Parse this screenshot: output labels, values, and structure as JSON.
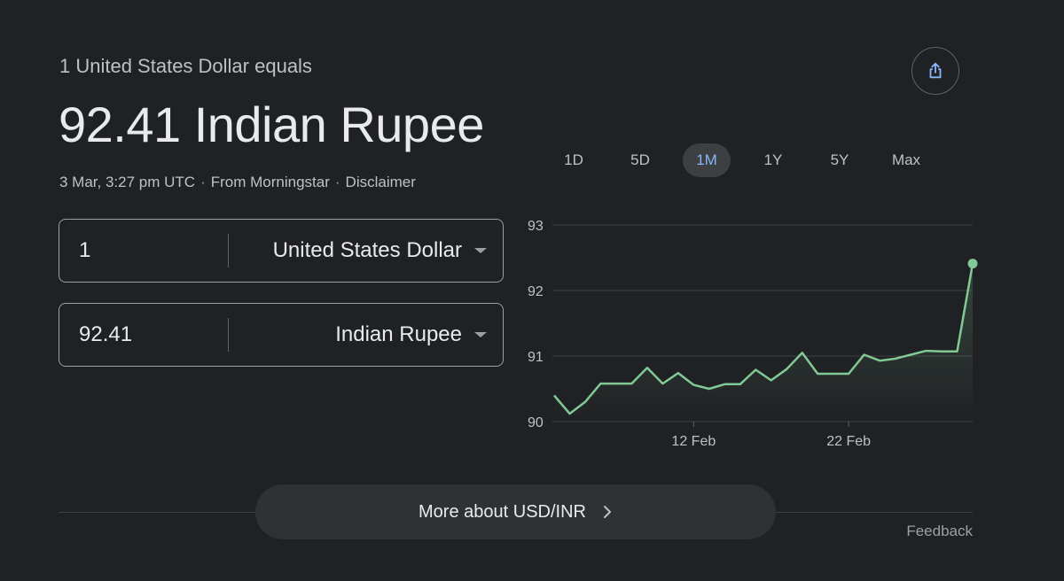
{
  "header": {
    "subtitle": "1 United States Dollar equals",
    "result": "92.41 Indian Rupee",
    "timestamp": "3 Mar, 3:27 pm UTC",
    "source": "From Morningstar",
    "disclaimer": "Disclaimer",
    "separator": "·"
  },
  "share": {
    "icon": "share-icon"
  },
  "converter": {
    "from": {
      "amount": "1",
      "currency": "United States Dollar"
    },
    "to": {
      "amount": "92.41",
      "currency": "Indian Rupee"
    }
  },
  "ranges": [
    {
      "label": "1D",
      "active": false
    },
    {
      "label": "5D",
      "active": false
    },
    {
      "label": "1M",
      "active": true
    },
    {
      "label": "1Y",
      "active": false
    },
    {
      "label": "5Y",
      "active": false
    },
    {
      "label": "Max",
      "active": false
    }
  ],
  "chart_data": {
    "type": "line",
    "y_ticks": [
      "93",
      "92",
      "91",
      "90"
    ],
    "ylim": [
      90,
      93
    ],
    "x_ticks": [
      {
        "label": "12 Feb",
        "index": 9
      },
      {
        "label": "22 Feb",
        "index": 19
      }
    ],
    "values": [
      90.4,
      90.12,
      90.3,
      90.58,
      90.58,
      90.58,
      90.82,
      90.58,
      90.74,
      90.56,
      90.5,
      90.57,
      90.57,
      90.79,
      90.63,
      90.8,
      91.05,
      90.73,
      90.73,
      90.73,
      91.02,
      90.93,
      90.96,
      91.02,
      91.08,
      91.07,
      91.07,
      92.41
    ],
    "grid": true,
    "line_color": "#81c995"
  },
  "more_button": {
    "label": "More about USD/INR"
  },
  "feedback": {
    "label": "Feedback"
  }
}
